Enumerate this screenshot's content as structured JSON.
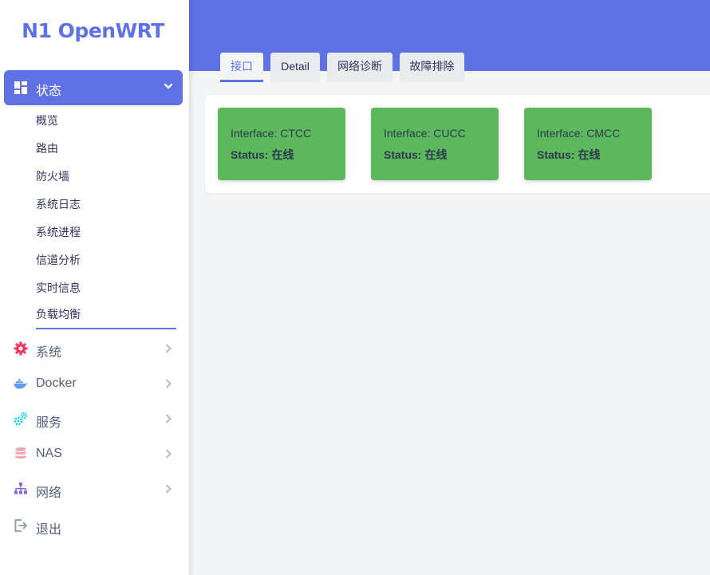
{
  "brand": {
    "title": "N1 OpenWRT",
    "color": "#5e72e4"
  },
  "sidebar": {
    "active": {
      "label": "状态",
      "icon": "dashboard-icon"
    },
    "submenu": [
      "概览",
      "路由",
      "防火墙",
      "系统日志",
      "系统进程",
      "信道分析",
      "实时信息",
      "负载均衡"
    ],
    "items": [
      {
        "label": "系统",
        "icon": "gear-icon",
        "color": "#f5365c"
      },
      {
        "label": "Docker",
        "icon": "docker-icon",
        "color": "#5e9cf5"
      },
      {
        "label": "服务",
        "icon": "cogs-icon",
        "color": "#11cdef"
      },
      {
        "label": "NAS",
        "icon": "database-icon",
        "color": "#f3a4b5"
      },
      {
        "label": "网络",
        "icon": "sitemap-icon",
        "color": "#8965e0"
      },
      {
        "label": "退出",
        "icon": "sign-out-icon",
        "color": "#8898aa"
      }
    ]
  },
  "tabs": [
    "接口",
    "Detail",
    "网络诊断",
    "故障排除"
  ],
  "interfaces": [
    {
      "interface_label": "Interface:",
      "name": "CTCC",
      "status_label": "Status:",
      "status": "在线"
    },
    {
      "interface_label": "Interface:",
      "name": "CUCC",
      "status_label": "Status:",
      "status": "在线"
    },
    {
      "interface_label": "Interface:",
      "name": "CMCC",
      "status_label": "Status:",
      "status": "在线"
    }
  ]
}
